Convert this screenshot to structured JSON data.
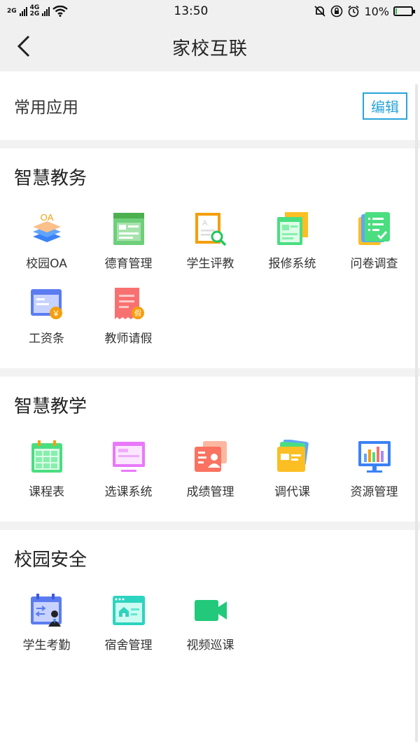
{
  "status_bar": {
    "net1": "2G",
    "net2a": "4G",
    "net2b": "2G",
    "time": "13:50",
    "battery": "10%",
    "battery_level": 0.1
  },
  "nav": {
    "title": "家校互联",
    "back_icon": "chevron-left-icon"
  },
  "common": {
    "title": "常用应用",
    "edit_label": "编辑"
  },
  "sections": [
    {
      "title": "智慧教务",
      "items": [
        {
          "label": "校园OA",
          "icon": "oa-layers-icon"
        },
        {
          "label": "德育管理",
          "icon": "moral-board-icon"
        },
        {
          "label": "学生评教",
          "icon": "evaluate-search-icon"
        },
        {
          "label": "报修系统",
          "icon": "repair-window-icon"
        },
        {
          "label": "问卷调查",
          "icon": "survey-check-icon"
        },
        {
          "label": "工资条",
          "icon": "salary-card-icon"
        },
        {
          "label": "教师请假",
          "icon": "leave-receipt-icon"
        }
      ]
    },
    {
      "title": "智慧教学",
      "items": [
        {
          "label": "课程表",
          "icon": "timetable-icon"
        },
        {
          "label": "选课系统",
          "icon": "course-select-icon"
        },
        {
          "label": "成绩管理",
          "icon": "grades-card-icon"
        },
        {
          "label": "调代课",
          "icon": "swap-class-icon"
        },
        {
          "label": "资源管理",
          "icon": "resource-chart-icon"
        }
      ]
    },
    {
      "title": "校园安全",
      "items": [
        {
          "label": "学生考勤",
          "icon": "attendance-icon"
        },
        {
          "label": "宿舍管理",
          "icon": "dormitory-icon"
        },
        {
          "label": "视频巡课",
          "icon": "video-camera-icon"
        }
      ]
    }
  ]
}
